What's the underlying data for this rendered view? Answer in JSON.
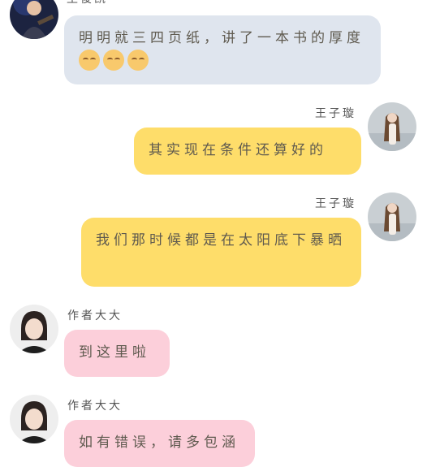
{
  "messages": [
    {
      "sender": "王俊凯",
      "text": "明明就三四页纸，讲了一本书的厚度",
      "emoji": [
        "smile-emoji",
        "smile-emoji",
        "smile-emoji"
      ]
    },
    {
      "sender": "王子璇",
      "text": "其实现在条件还算好的"
    },
    {
      "sender": "王子璇",
      "text": "我们那时候都是在太阳底下暴晒"
    },
    {
      "sender": "作者大大",
      "text": "到这里啦"
    },
    {
      "sender": "作者大大",
      "text": "如有错误，请多包涵"
    }
  ],
  "colors": {
    "bubble_grey": "#dfe5ee",
    "bubble_yellow": "#fedd6a",
    "bubble_pink": "#fccfda"
  }
}
